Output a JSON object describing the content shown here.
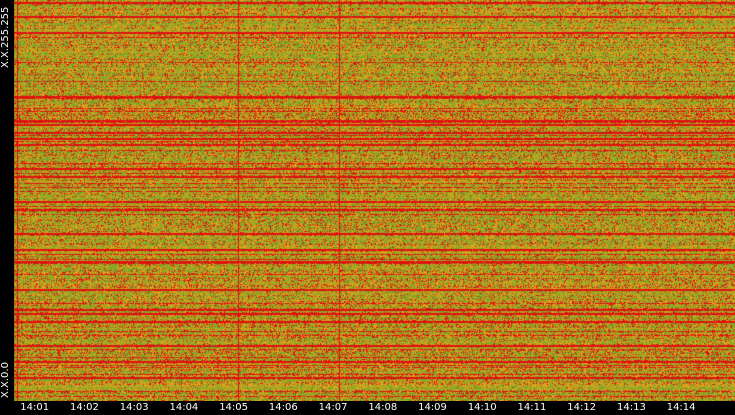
{
  "chart_data": {
    "type": "heatmap",
    "title": "",
    "xlabel": "",
    "ylabel": "",
    "x_tick_labels": [
      "14:01",
      "14:02",
      "14:03",
      "14:04",
      "14:05",
      "14:06",
      "14:07",
      "14:08",
      "14:09",
      "14:10",
      "14:11",
      "14:12",
      "14:13",
      "14:14"
    ],
    "y_tick_labels": {
      "top": "X.X.255.255",
      "bottom": "X.X.0.0"
    },
    "x_range": [
      "14:00:35",
      "14:15:05"
    ],
    "y_range": [
      "X.X.0.0",
      "X.X.255.255"
    ],
    "color_scale": [
      "#7aa82a",
      "#e1a21a",
      "#e01010"
    ],
    "highlighted_rows_fraction_from_top": [
      0.005,
      0.04,
      0.08,
      0.24,
      0.3,
      0.31,
      0.33,
      0.345,
      0.36,
      0.42,
      0.44,
      0.5,
      0.52,
      0.58,
      0.62,
      0.65,
      0.72,
      0.77,
      0.78,
      0.8,
      0.86,
      0.9,
      0.94
    ],
    "highlighted_times": [
      "14:00:39",
      "14:05:05",
      "14:07:07"
    ],
    "grid": false
  },
  "colors": {
    "background": "#000000",
    "text": "#ffffff"
  }
}
